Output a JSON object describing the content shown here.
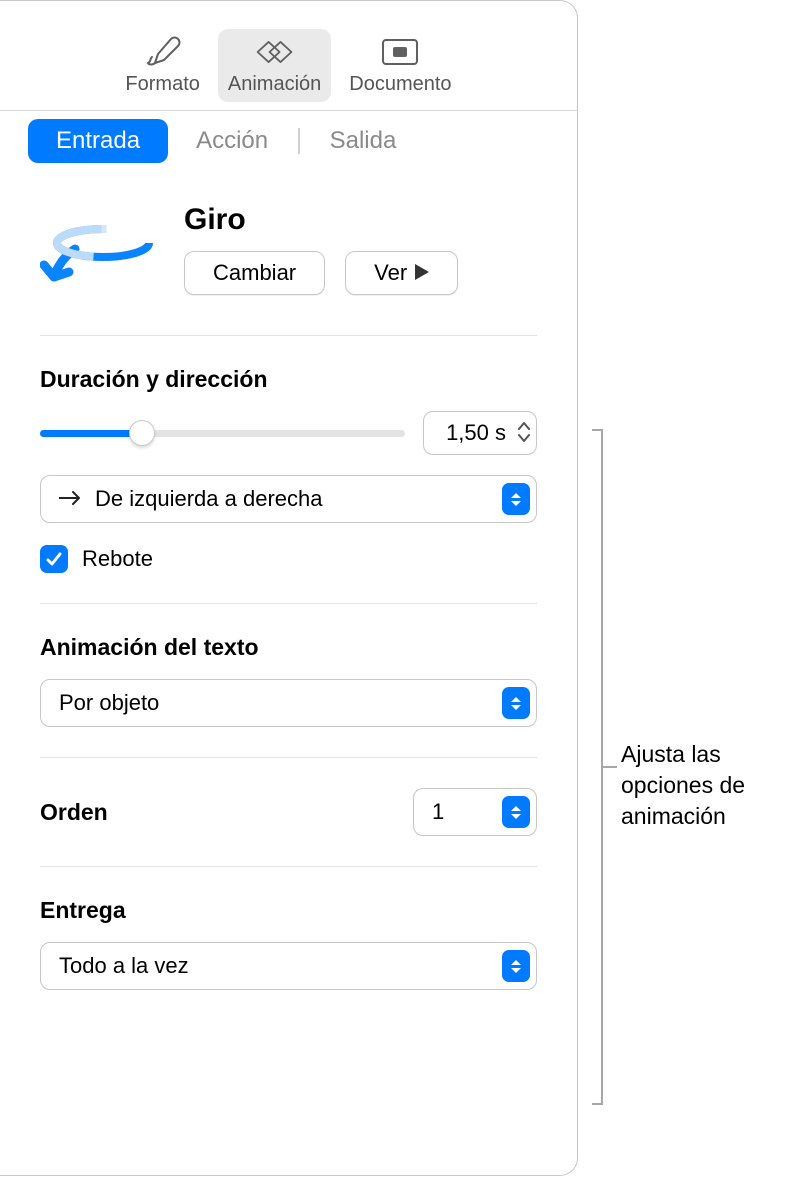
{
  "toolbar": {
    "format": "Formato",
    "animation": "Animación",
    "document": "Documento"
  },
  "subtabs": {
    "in": "Entrada",
    "action": "Acción",
    "out": "Salida"
  },
  "effect": {
    "name": "Giro",
    "change_label": "Cambiar",
    "preview_label": "Ver"
  },
  "duration": {
    "title": "Duración y dirección",
    "value": "1,50 s",
    "direction": "De izquierda a derecha",
    "bounce_label": "Rebote"
  },
  "textanim": {
    "title": "Animación del texto",
    "value": "Por objeto"
  },
  "order": {
    "title": "Orden",
    "value": "1"
  },
  "delivery": {
    "title": "Entrega",
    "value": "Todo a la vez"
  },
  "callout": "Ajusta las opciones de animación"
}
